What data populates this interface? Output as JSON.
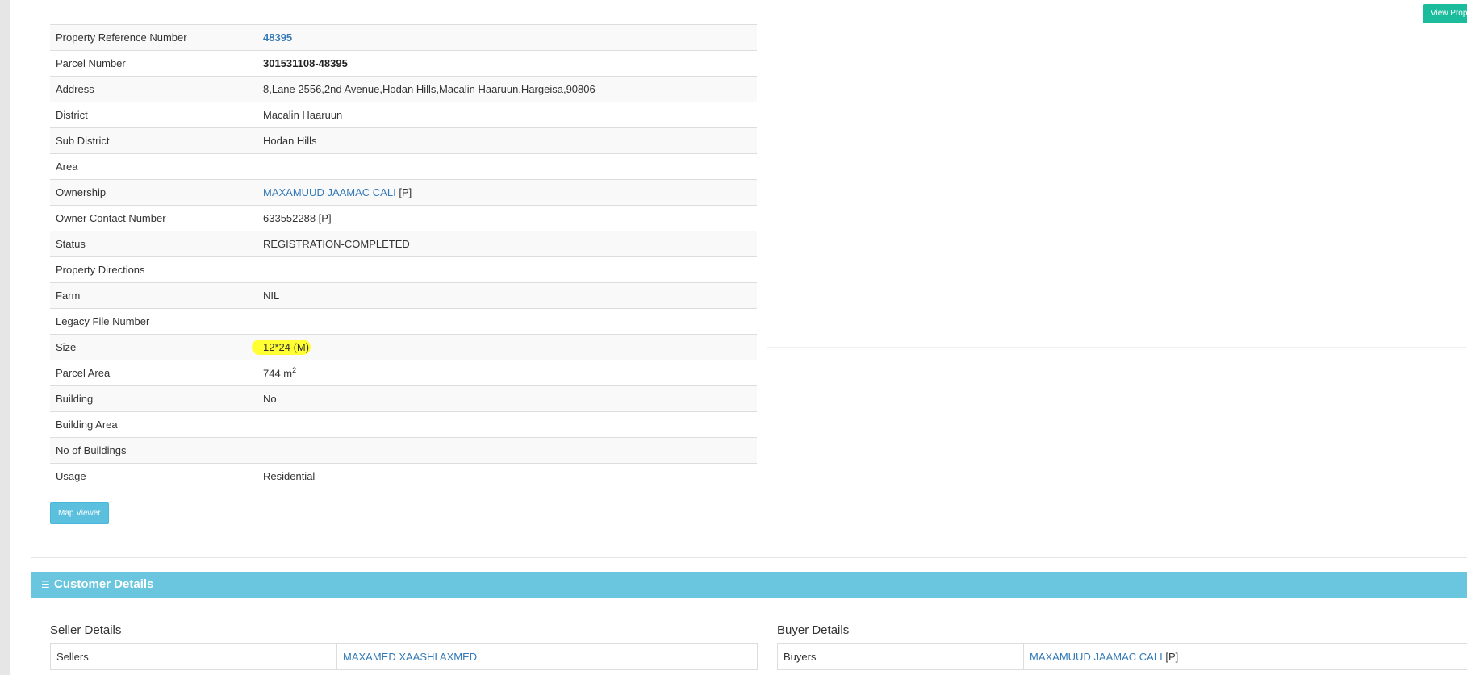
{
  "actions": {
    "view_property_label": "View Prope",
    "map_viewer_label": "Map Viewer"
  },
  "property": {
    "rows": [
      {
        "label": "Property Reference Number",
        "value": "48395"
      },
      {
        "label": "Parcel Number",
        "value": "301531108-48395"
      },
      {
        "label": "Address",
        "value": "8,Lane 2556,2nd Avenue,Hodan Hills,Macalin Haaruun,Hargeisa,90806"
      },
      {
        "label": "District",
        "value": "Macalin Haaruun"
      },
      {
        "label": "Sub District",
        "value": "Hodan Hills"
      },
      {
        "label": "Area",
        "value": ""
      },
      {
        "label": "Ownership",
        "value": "MAXAMUUD JAAMAC CALI",
        "suffix": "[P]"
      },
      {
        "label": "Owner Contact Number",
        "value": "633552288 [P]"
      },
      {
        "label": "Status",
        "value": "REGISTRATION-COMPLETED"
      },
      {
        "label": "Property Directions",
        "value": ""
      },
      {
        "label": "Farm",
        "value": "NIL"
      },
      {
        "label": "Legacy File Number",
        "value": ""
      },
      {
        "label": "Size",
        "value": "12*24 (M)"
      },
      {
        "label": "Parcel Area",
        "value": "744 m",
        "unit_sup": "2"
      },
      {
        "label": "Building",
        "value": "No"
      },
      {
        "label": "Building Area",
        "value": ""
      },
      {
        "label": "No of Buildings",
        "value": ""
      },
      {
        "label": "Usage",
        "value": "Residential"
      }
    ]
  },
  "customer": {
    "header_icon": "list-icon",
    "header_title": "Customer Details",
    "seller": {
      "title": "Seller Details",
      "label": "Sellers",
      "value": "MAXAMED XAASHI AXMED"
    },
    "buyer": {
      "title": "Buyer Details",
      "label": "Buyers",
      "value": "MAXAMUUD JAAMAC CALI",
      "suffix": "[P]"
    }
  },
  "colors": {
    "accent_info": "#5bc0de",
    "accent_success": "#1abc9c",
    "header_bg": "#6ac5df",
    "link": "#337ab7",
    "highlight": "#ffff33"
  }
}
